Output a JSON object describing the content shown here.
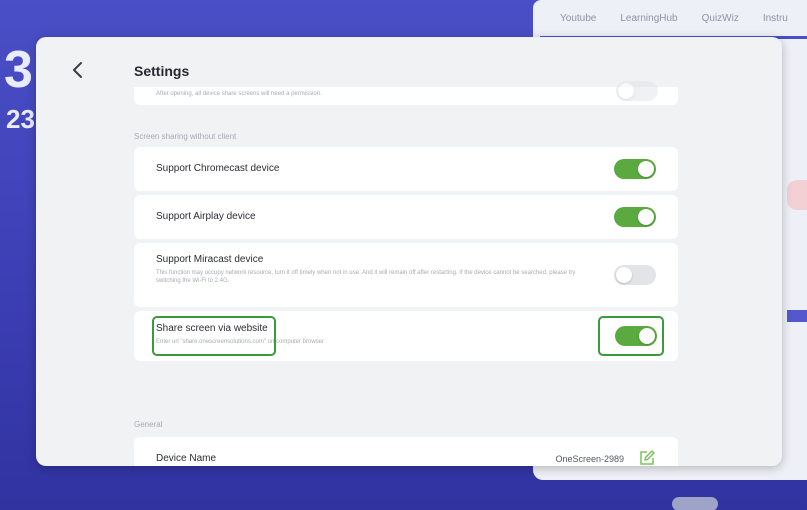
{
  "background": {
    "big_number": "3",
    "small_number": "23",
    "tabs": [
      "Youtube",
      "LearningHub",
      "QuizWiz",
      "Instru"
    ]
  },
  "dialog": {
    "title": "Settings",
    "back_icon": "chevron-left-icon",
    "partial_row_desc": "After opening, all device share screens will need a permission.",
    "sections": {
      "screen_sharing": "Screen sharing without client",
      "general": "General"
    },
    "rows": {
      "chromecast": {
        "label": "Support Chromecast device",
        "enabled": true
      },
      "airplay": {
        "label": "Support Airplay device",
        "enabled": true
      },
      "miracast": {
        "label": "Support Miracast device",
        "desc": "This function may occupy network resource, turn it off timely when not in use. And it will remain off after restarting. If the device cannot be searched, please try switching the Wi-Fi to 2.4G.",
        "enabled": false
      },
      "website": {
        "label": "Share screen via website",
        "desc": "Enter url \"share.onescreensolutions.com\" on computer browser",
        "enabled": true
      },
      "device_name": {
        "label": "Device Name",
        "value": "OneScreen-2989",
        "edit_icon": "edit-icon"
      }
    },
    "colors": {
      "toggle_on": "#5aaa3f",
      "toggle_off": "#e3e4e7",
      "highlight": "#3a9a3d"
    }
  }
}
